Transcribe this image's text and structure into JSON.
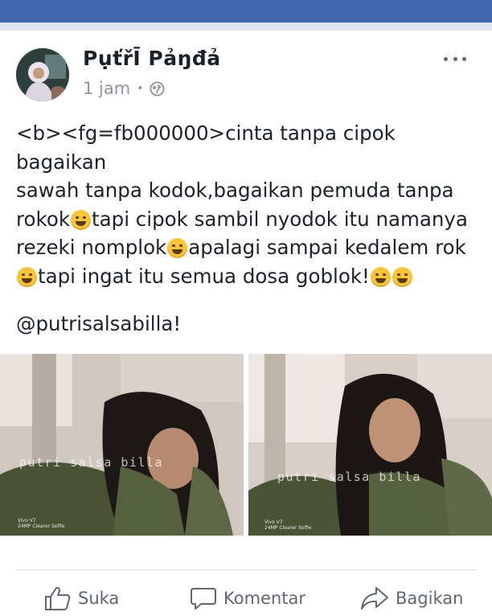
{
  "post": {
    "author": "PụťřĪ Pảŋđả",
    "time": "1 jam",
    "separator": "•",
    "privacy_icon": "globe-icon",
    "text_lines": [
      "<b><fg=fb000000>cinta tanpa cipok bagaikan",
      "sawah tanpa kodok,bagaikan pemuda tanpa",
      "rokok",
      "tapi cipok sambil nyodok itu namanya",
      "rezeki nomplok",
      "apalagi sampai kedalem rok",
      "tapi ingat itu semua dosa goblok!"
    ],
    "mention": "@putrisalsabilla!"
  },
  "photos": [
    {
      "watermark": "putri salsa billa",
      "camera_line1": "Vivo V7",
      "camera_line2": "24MP Clearer Selfie"
    },
    {
      "watermark": "putri salsa billa",
      "camera_line1": "Vivo V7",
      "camera_line2": "24MP Clearer Selfie"
    }
  ],
  "actions": {
    "like": "Suka",
    "comment": "Komentar",
    "share": "Bagikan"
  },
  "colors": {
    "brand": "#4267b2",
    "text": "#1d2129",
    "meta": "#90949c",
    "action": "#606770"
  }
}
